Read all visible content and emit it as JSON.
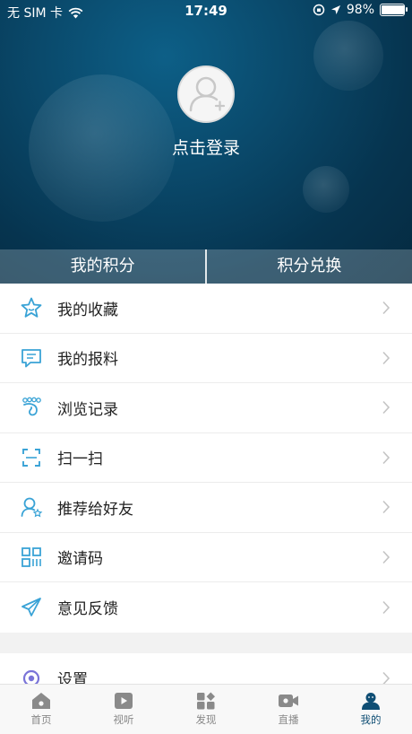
{
  "status_bar": {
    "carrier": "无 SIM 卡",
    "time": "17:49",
    "battery": "98%",
    "battery_level": 0.98
  },
  "profile": {
    "login_label": "点击登录"
  },
  "points_bar": {
    "my_points": "我的积分",
    "exchange": "积分兑换"
  },
  "menu": [
    {
      "label": "我的收藏",
      "icon": "star-icon"
    },
    {
      "label": "我的报料",
      "icon": "message-icon"
    },
    {
      "label": "浏览记录",
      "icon": "history-icon"
    },
    {
      "label": "扫一扫",
      "icon": "scan-icon"
    },
    {
      "label": "推荐给好友",
      "icon": "recommend-icon"
    },
    {
      "label": "邀请码",
      "icon": "qrcode-icon"
    },
    {
      "label": "意见反馈",
      "icon": "feedback-icon"
    }
  ],
  "settings": {
    "label": "设置",
    "icon": "settings-icon"
  },
  "tabbar": [
    {
      "label": "首页",
      "icon": "home-icon"
    },
    {
      "label": "视听",
      "icon": "video-icon"
    },
    {
      "label": "发现",
      "icon": "discover-icon"
    },
    {
      "label": "直播",
      "icon": "live-icon"
    },
    {
      "label": "我的",
      "icon": "profile-icon",
      "active": true
    }
  ],
  "colors": {
    "accent": "#0f4e74",
    "icon_blue": "#3aa3d6"
  }
}
